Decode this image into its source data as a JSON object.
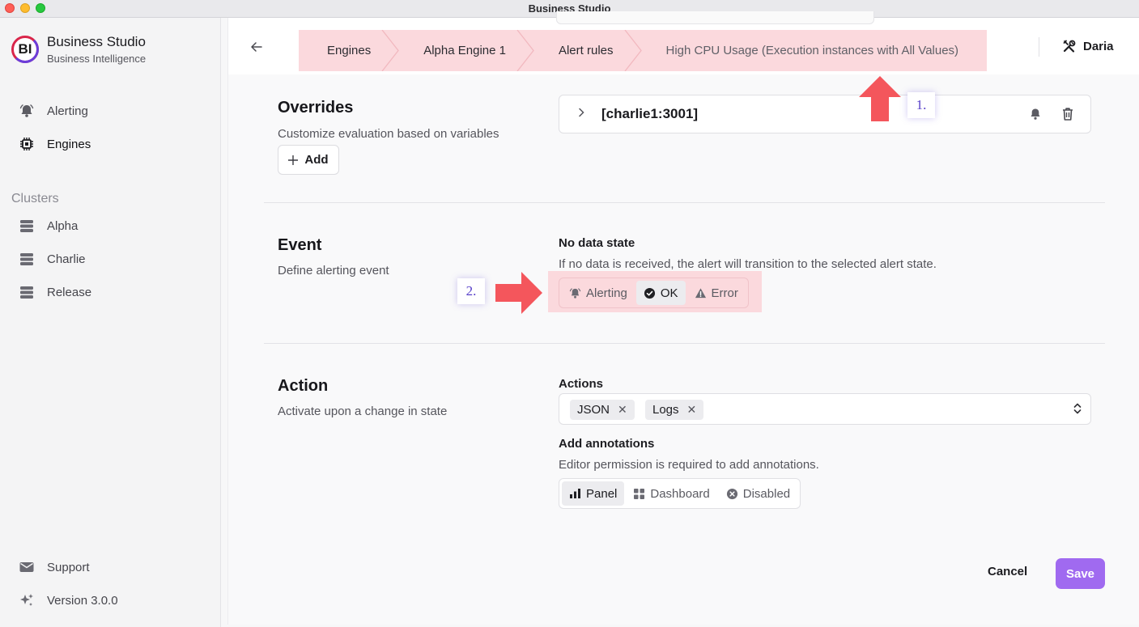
{
  "window": {
    "title": "Business Studio"
  },
  "sidebar": {
    "brand": {
      "logo_text": "BI",
      "name": "Business Studio",
      "subtitle": "Business Intelligence"
    },
    "nav": [
      {
        "label": "Alerting",
        "icon": "bell-icon"
      },
      {
        "label": "Engines",
        "icon": "chip-icon",
        "active": true
      }
    ],
    "clusters_label": "Clusters",
    "clusters": [
      {
        "label": "Alpha",
        "icon": "server-icon"
      },
      {
        "label": "Charlie",
        "icon": "server-icon"
      },
      {
        "label": "Release",
        "icon": "server-icon"
      }
    ],
    "footer": [
      {
        "label": "Support",
        "icon": "mail-icon"
      },
      {
        "label": "Version 3.0.0",
        "icon": "sparkle-icon"
      }
    ]
  },
  "header": {
    "breadcrumbs": [
      "Engines",
      "Alpha Engine 1",
      "Alert rules",
      "High CPU Usage (Execution instances with All Values)"
    ],
    "user": "Daria"
  },
  "overrides": {
    "title": "Overrides",
    "description": "Customize evaluation based on variables",
    "add_label": "Add",
    "items": [
      {
        "label": "[charlie1:3001]"
      }
    ]
  },
  "event": {
    "title": "Event",
    "description": "Define alerting event",
    "no_data_title": "No data state",
    "no_data_help": "If no data is received, the alert will transition to the selected alert state.",
    "options": [
      {
        "label": "Alerting",
        "icon": "bell-icon"
      },
      {
        "label": "OK",
        "icon": "check-circle-icon",
        "selected": true
      },
      {
        "label": "Error",
        "icon": "warning-icon"
      }
    ]
  },
  "action": {
    "title": "Action",
    "description": "Activate upon a change in state",
    "actions_title": "Actions",
    "chips": [
      "JSON",
      "Logs"
    ],
    "annotations_title": "Add annotations",
    "annotations_help": "Editor permission is required to add annotations.",
    "annotation_options": [
      {
        "label": "Panel",
        "icon": "bar-chart-icon",
        "selected": true
      },
      {
        "label": "Dashboard",
        "icon": "grid-icon"
      },
      {
        "label": "Disabled",
        "icon": "x-circle-icon"
      }
    ]
  },
  "footer_buttons": {
    "cancel": "Cancel",
    "save": "Save"
  },
  "callouts": {
    "one": "1.",
    "two": "2."
  },
  "colors": {
    "accent": "#a06af0",
    "highlight": "#fbd9dd",
    "callout_arrow": "#f4565c"
  }
}
